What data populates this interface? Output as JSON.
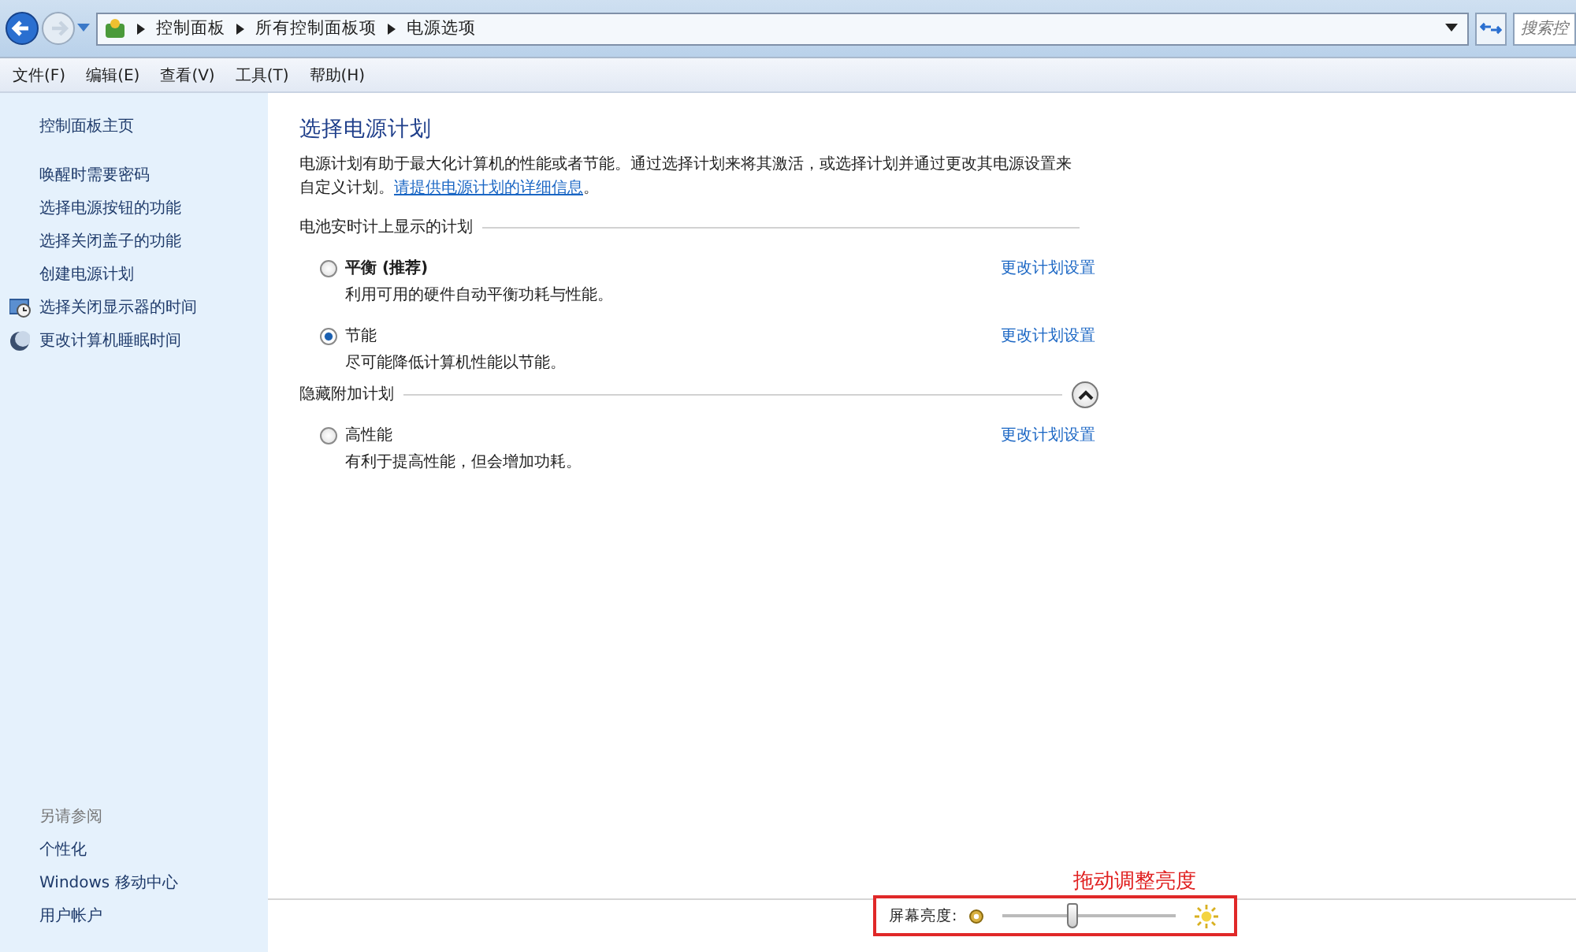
{
  "address_bar": {
    "breadcrumb": [
      "控制面板",
      "所有控制面板项",
      "电源选项"
    ],
    "search": {
      "placeholder": "搜索控"
    }
  },
  "menu": [
    "文件(F)",
    "编辑(E)",
    "查看(V)",
    "工具(T)",
    "帮助(H)"
  ],
  "sidebar": {
    "home": "控制面板主页",
    "tasks": [
      {
        "label": "唤醒时需要密码",
        "kind": "plain"
      },
      {
        "label": "选择电源按钮的功能",
        "kind": "plain"
      },
      {
        "label": "选择关闭盖子的功能",
        "kind": "plain"
      },
      {
        "label": "创建电源计划",
        "kind": "plain"
      },
      {
        "label": "选择关闭显示器的时间",
        "kind": "display"
      },
      {
        "label": "更改计算机睡眠时间",
        "kind": "sleep"
      }
    ],
    "see_also": {
      "title": "另请参阅",
      "links": [
        "个性化",
        "Windows 移动中心",
        "用户帐户"
      ]
    }
  },
  "main": {
    "title": "选择电源计划",
    "description": "电源计划有助于最大化计算机的性能或者节能。通过选择计划来将其激活，或选择计划并通过更改其电源设置来自定义计划。",
    "description_link": "请提供电源计划的详细信息",
    "description_end": "。",
    "sections": [
      {
        "title": "电池安时计上显示的计划",
        "collapsible": false,
        "plans": [
          {
            "name": "平衡 (推荐)",
            "emphasized": true,
            "description": "利用可用的硬件自动平衡功耗与性能。",
            "selected": false,
            "link": "更改计划设置"
          },
          {
            "name": "节能",
            "emphasized": false,
            "description": "尽可能降低计算机性能以节能。",
            "selected": true,
            "link": "更改计划设置"
          }
        ]
      },
      {
        "title": "隐藏附加计划",
        "collapsible": true,
        "expanded": true,
        "plans": [
          {
            "name": "高性能",
            "emphasized": false,
            "description": "有利于提高性能，但会增加功耗。",
            "selected": false,
            "link": "更改计划设置"
          }
        ]
      }
    ]
  },
  "brightness": {
    "label": "屏幕亮度:",
    "level": 0.4,
    "annotation": "拖动调整亮度"
  }
}
